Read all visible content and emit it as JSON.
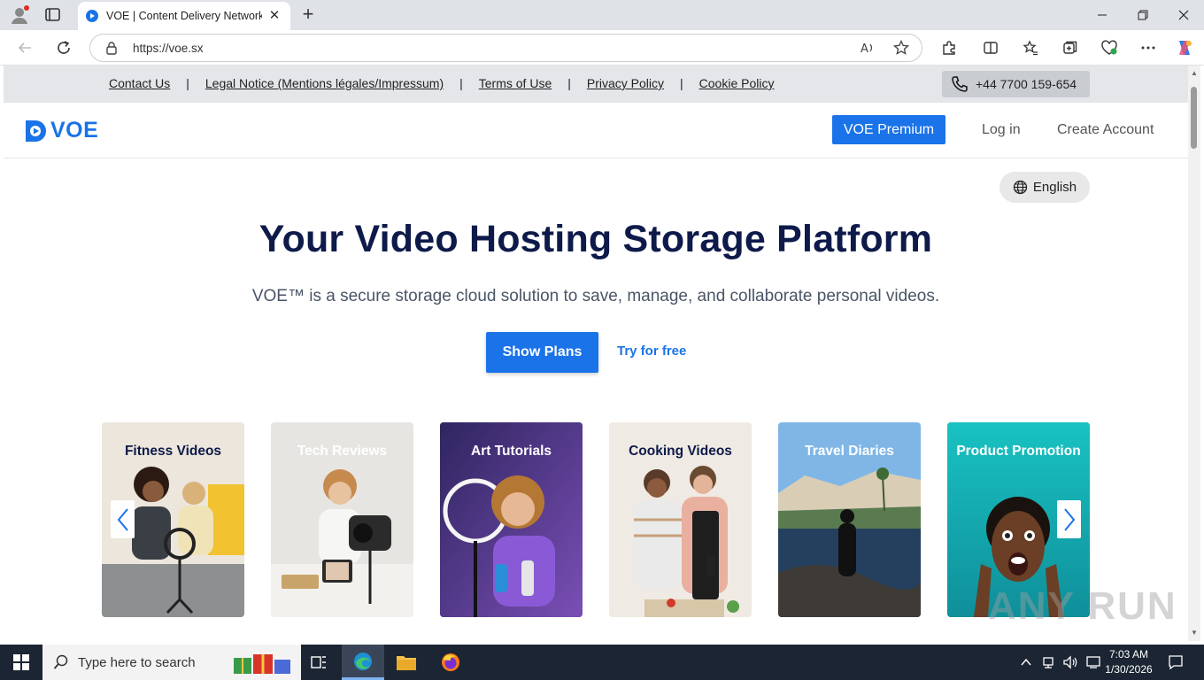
{
  "browser": {
    "tab_title": "VOE | Content Delivery Network (",
    "url": "https://voe.sx"
  },
  "page": {
    "toplinks": [
      "Contact Us",
      "Legal Notice (Mentions légales/Impressum)",
      "Terms of Use",
      "Privacy Policy",
      "Cookie Policy"
    ],
    "separator": "|",
    "phone": "+44 7700 159-654",
    "logo": "VOE",
    "premium": "VOE Premium",
    "login": "Log in",
    "create_account": "Create Account",
    "language": "English",
    "hero_title": "Your Video Hosting Storage Platform",
    "hero_subtitle": "VOE™ is a secure storage cloud solution to save, manage, and collaborate personal videos.",
    "show_plans": "Show Plans",
    "try_free": "Try for free",
    "cards": [
      "Fitness Videos",
      "Tech Reviews",
      "Art Tutorials",
      "Cooking Videos",
      "Travel Diaries",
      "Product Promotion"
    ],
    "watermark": "ANY RUN"
  },
  "taskbar": {
    "search_placeholder": "Type here to search",
    "time": "7:03 AM",
    "date": "1/30/2026"
  },
  "colors": {
    "brand_blue": "#1a73e8",
    "title_navy": "#0d1a4a"
  }
}
